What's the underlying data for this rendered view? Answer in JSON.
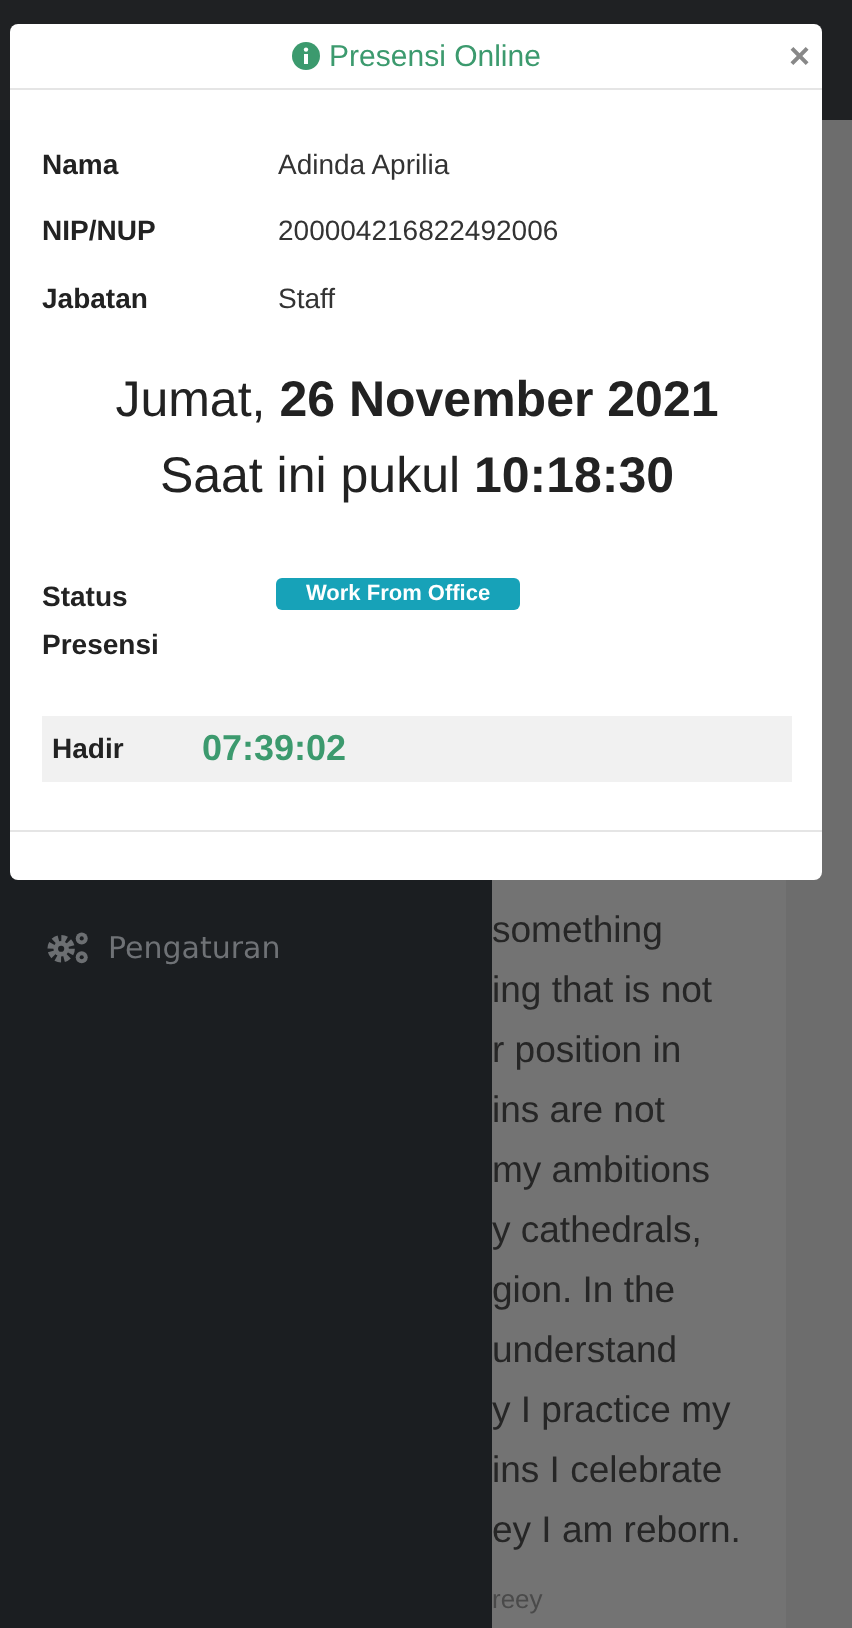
{
  "sidebar": {
    "items": [
      {
        "label": "Pengaturan"
      }
    ]
  },
  "card": {
    "lines": [
      "something",
      "ing that is not",
      "r position in",
      "ins are not",
      "my ambitions",
      "y cathedrals,",
      "gion. In the",
      "understand",
      "y I practice my",
      "ins I celebrate",
      "ey I am reborn."
    ],
    "footer": "reey"
  },
  "modal": {
    "title": "Presensi Online",
    "close": "×",
    "fields": [
      {
        "label": "Nama",
        "value": "Adinda Aprilia"
      },
      {
        "label": "NIP/NUP",
        "value": "200004216822492006"
      },
      {
        "label": "Jabatan",
        "value": "Staff"
      }
    ],
    "date": "Jumat, **26 November 2021**",
    "clock": "Saat ini pukul **10:18:30**",
    "status": {
      "label": "Status Presensi",
      "badge": "Work From Office"
    },
    "attendance": {
      "label": "Hadir",
      "time": "07:39:02"
    }
  }
}
